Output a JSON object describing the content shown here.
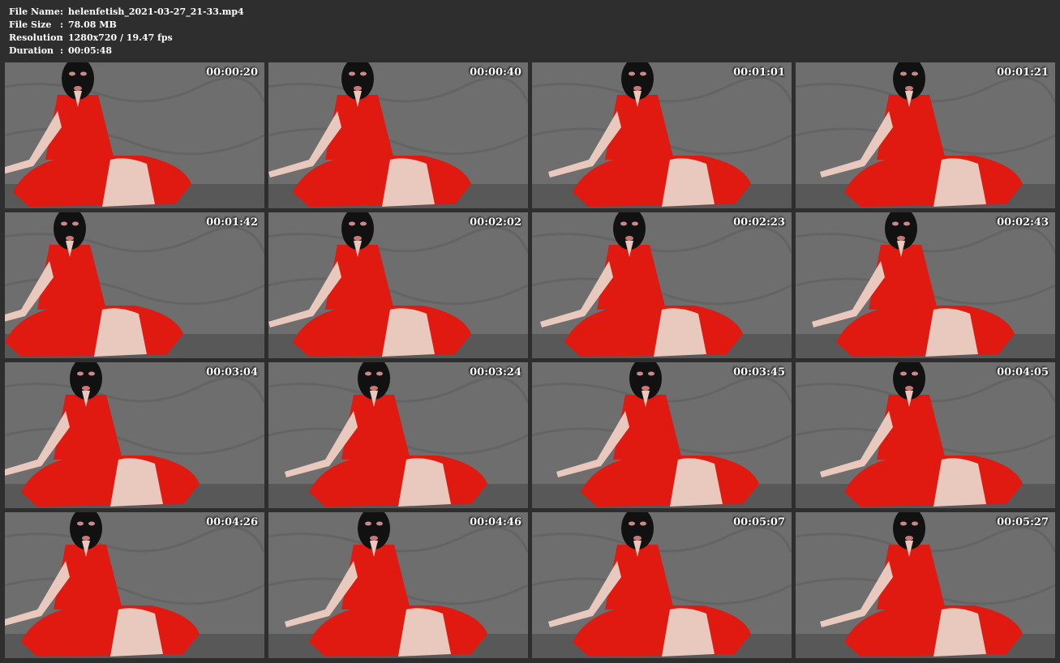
{
  "file_info": {
    "name_label": "File Name",
    "name_value": "helenfetish_2021-03-27_21-33.mp4",
    "size_label": "File Size",
    "size_value": "78.08 MB",
    "resolution_label": "Resolution",
    "resolution_value": "1280x720 / 19.47 fps",
    "duration_label": "Duration",
    "duration_value": "00:05:48",
    "separator": ":"
  },
  "thumbnails": [
    {
      "timestamp": "00:00:20"
    },
    {
      "timestamp": "00:00:40"
    },
    {
      "timestamp": "00:01:01"
    },
    {
      "timestamp": "00:01:21"
    },
    {
      "timestamp": "00:01:42"
    },
    {
      "timestamp": "00:02:02"
    },
    {
      "timestamp": "00:02:23"
    },
    {
      "timestamp": "00:02:43"
    },
    {
      "timestamp": "00:03:04"
    },
    {
      "timestamp": "00:03:24"
    },
    {
      "timestamp": "00:03:45"
    },
    {
      "timestamp": "00:04:05"
    },
    {
      "timestamp": "00:04:26"
    },
    {
      "timestamp": "00:04:46"
    },
    {
      "timestamp": "00:05:07"
    },
    {
      "timestamp": "00:05:27"
    }
  ],
  "colors": {
    "background": "#2e2e2e",
    "text": "#ffffff",
    "wall": "#6e6e6e",
    "dress": "#e01a10",
    "mask": "#111111",
    "skin": "#e9c9bd"
  }
}
